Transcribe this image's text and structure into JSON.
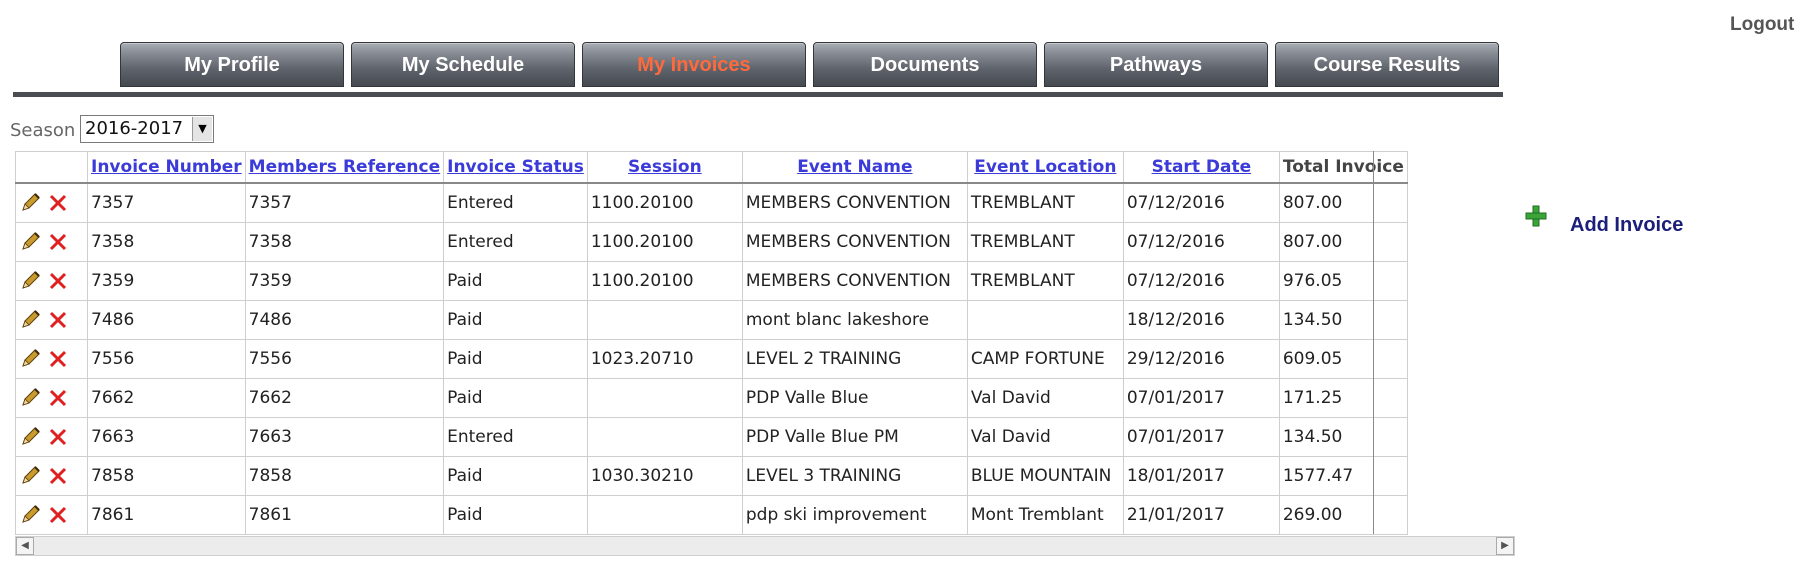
{
  "header": {
    "logout_label": "Logout"
  },
  "tabs": [
    {
      "label": "My Profile",
      "active": false
    },
    {
      "label": "My Schedule",
      "active": false
    },
    {
      "label": "My Invoices",
      "active": true
    },
    {
      "label": "Documents",
      "active": false
    },
    {
      "label": "Pathways",
      "active": false
    },
    {
      "label": "Course Results",
      "active": false
    }
  ],
  "season": {
    "label": "Season",
    "selected": "2016-2017"
  },
  "table": {
    "columns": [
      "Invoice Number",
      "Members Reference",
      "Invoice Status",
      "Session",
      "Event Name",
      "Event Location",
      "Start Date",
      "Total Invoice"
    ],
    "rows": [
      [
        "7357",
        "7357",
        "Entered",
        "1100.20100",
        "MEMBERS CONVENTION",
        "TREMBLANT",
        "07/12/2016",
        "807.00"
      ],
      [
        "7358",
        "7358",
        "Entered",
        "1100.20100",
        "MEMBERS CONVENTION",
        "TREMBLANT",
        "07/12/2016",
        "807.00"
      ],
      [
        "7359",
        "7359",
        "Paid",
        "1100.20100",
        "MEMBERS CONVENTION",
        "TREMBLANT",
        "07/12/2016",
        "976.05"
      ],
      [
        "7486",
        "7486",
        "Paid",
        "",
        "mont blanc lakeshore",
        "",
        "18/12/2016",
        "134.50"
      ],
      [
        "7556",
        "7556",
        "Paid",
        "1023.20710",
        "LEVEL 2 TRAINING",
        "CAMP FORTUNE",
        "29/12/2016",
        "609.05"
      ],
      [
        "7662",
        "7662",
        "Paid",
        "",
        "PDP Valle Blue",
        "Val David",
        "07/01/2017",
        "171.25"
      ],
      [
        "7663",
        "7663",
        "Entered",
        "",
        "PDP Valle Blue PM",
        "Val David",
        "07/01/2017",
        "134.50"
      ],
      [
        "7858",
        "7858",
        "Paid",
        "1030.30210",
        "LEVEL 3 TRAINING",
        "BLUE MOUNTAIN",
        "18/01/2017",
        "1577.47"
      ],
      [
        "7861",
        "7861",
        "Paid",
        "",
        "pdp ski improvement",
        "Mont Tremblant",
        "21/01/2017",
        "269.00"
      ]
    ]
  },
  "actions": {
    "add_invoice_label": "Add Invoice"
  },
  "icons": {
    "edit": "pencil-icon",
    "delete": "delete-x-icon",
    "add": "plus-icon"
  },
  "colors": {
    "active_tab": "#ff6a3d",
    "link": "#3b3bd9",
    "delete": "#e02020",
    "add_green": "#3aa43a",
    "add_text": "#1b1f7a"
  }
}
